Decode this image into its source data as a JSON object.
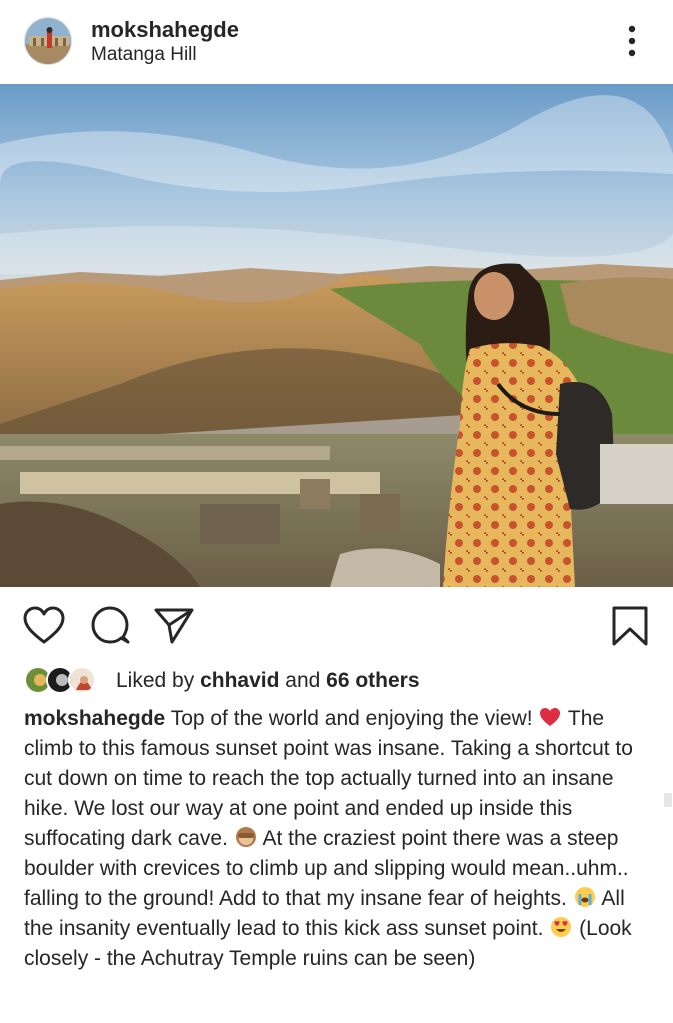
{
  "post": {
    "username": "mokshahegde",
    "location": "Matanga Hill",
    "image_alt": "Woman on Matanga Hill overlooking boulders and Achutraya Temple ruins at sunset"
  },
  "icons": {
    "more": "more-vertical-icon",
    "like": "heart-icon",
    "comment": "comment-icon",
    "share": "send-icon",
    "save": "bookmark-icon"
  },
  "likes": {
    "prefix": "Liked by",
    "user": "chhavid",
    "joiner": "and",
    "others": "66 others"
  },
  "caption": {
    "username": "mokshahegde",
    "part1": "Top of the world and enjoying the view!",
    "part2": "The climb to this famous sunset point was insane. Taking a shortcut to cut down on time to reach the top actually turned into an insane hike. We lost our way at one point and ended up inside this suffocating dark cave.",
    "part3": "At the craziest point there was a steep boulder with crevices to climb up and slipping would mean..uhm.. falling to the ground! Add to that my insane fear of heights.",
    "part4": "All the insanity eventually lead to this kick ass sunset point.",
    "part5": "(Look closely - the Achutray Temple ruins can be seen)"
  },
  "colors": {
    "text": "#262626",
    "heart_emoji": "#e0245e"
  }
}
